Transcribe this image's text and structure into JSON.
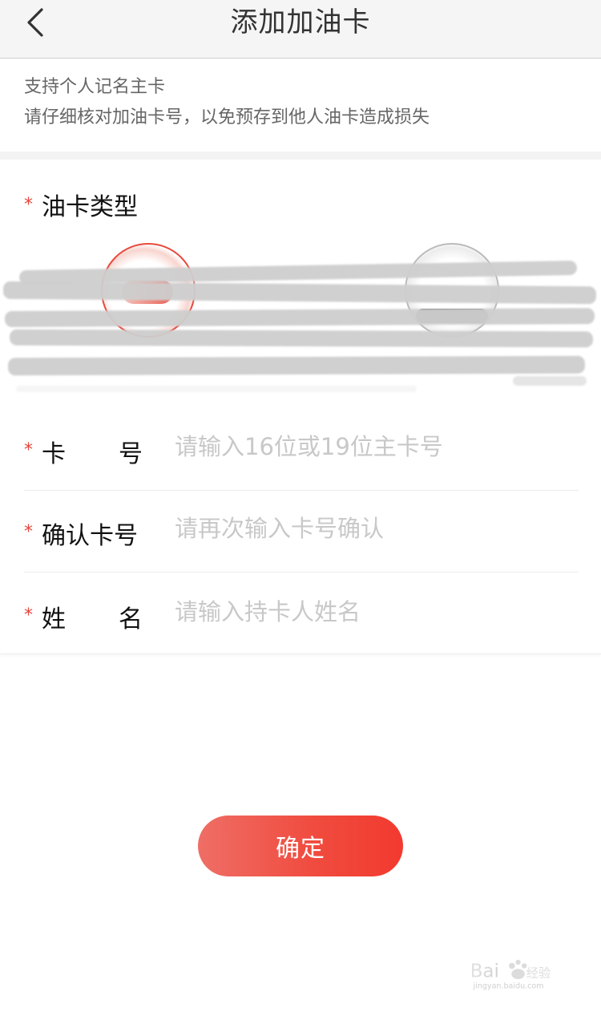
{
  "header": {
    "title": "添加加油卡"
  },
  "notice": {
    "line1": "支持个人记名主卡",
    "line2": "请仔细核对加油卡号，以免预存到他人油卡造成损失"
  },
  "form": {
    "required_mark": "*",
    "card_type_label": "油卡类型",
    "card_number": {
      "label_left": "卡",
      "label_right": "号",
      "placeholder": "请输入16位或19位主卡号"
    },
    "confirm_card_number": {
      "label": "确认卡号",
      "placeholder": "请再次输入卡号确认"
    },
    "cardholder_name": {
      "label_left": "姓",
      "label_right": "名",
      "placeholder": "请输入持卡人姓名"
    }
  },
  "actions": {
    "confirm_label": "确定"
  },
  "watermark": {
    "brand": "Bai 经验",
    "url": "jingyan.baidu.com"
  },
  "colors": {
    "accent": "#f04c3f",
    "required": "#e8443a",
    "placeholder": "#c8c8c8",
    "header_bg": "#f5f5f5"
  },
  "icons": {
    "back": "chevron-left-icon"
  }
}
